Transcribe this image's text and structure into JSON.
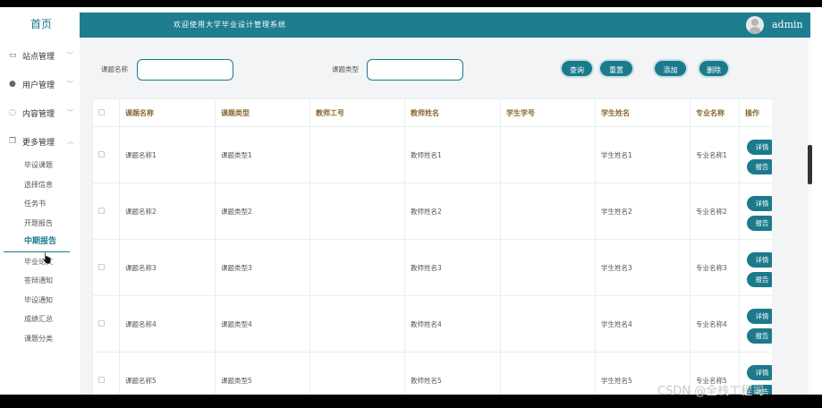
{
  "sidebar": {
    "home": "首页",
    "groups": [
      {
        "label": "站点管理",
        "icon": "monitor-icon"
      },
      {
        "label": "用户管理",
        "icon": "user-icon"
      },
      {
        "label": "内容管理",
        "icon": "chat-icon"
      },
      {
        "label": "更多管理",
        "icon": "copy-icon"
      }
    ],
    "items": [
      "毕设课题",
      "选择信息",
      "任务书",
      "开题报告",
      "中期报告",
      "毕业论文",
      "答辩通知",
      "毕设通知",
      "成绩汇总",
      "课题分类"
    ],
    "active_item": "中期报告"
  },
  "header": {
    "welcome": "欢迎使用大学毕业设计管理系统",
    "username": "admin"
  },
  "search": {
    "title_label": "课题名称",
    "title_value": "",
    "type_label": "课题类型",
    "type_value": ""
  },
  "buttons": {
    "query": "查询",
    "reset": "重置",
    "add": "添加",
    "delete": "删除"
  },
  "table": {
    "headers": [
      "课题名称",
      "课题类型",
      "教师工号",
      "教师姓名",
      "学生学号",
      "学生姓名",
      "专业名称",
      "操作"
    ],
    "rows": [
      {
        "title": "课题名称1",
        "type": "课题类型1",
        "teacher_id": "",
        "teacher_name": "教师姓名1",
        "student_id": "",
        "student_name": "学生姓名1",
        "major": "专业名称1"
      },
      {
        "title": "课题名称2",
        "type": "课题类型2",
        "teacher_id": "",
        "teacher_name": "教师姓名2",
        "student_id": "",
        "student_name": "学生姓名2",
        "major": "专业名称2"
      },
      {
        "title": "课题名称3",
        "type": "课题类型3",
        "teacher_id": "",
        "teacher_name": "教师姓名3",
        "student_id": "",
        "student_name": "学生姓名3",
        "major": "专业名称3"
      },
      {
        "title": "课题名称4",
        "type": "课题类型4",
        "teacher_id": "",
        "teacher_name": "教师姓名4",
        "student_id": "",
        "student_name": "学生姓名4",
        "major": "专业名称4"
      },
      {
        "title": "课题名称5",
        "type": "课题类型5",
        "teacher_id": "",
        "teacher_name": "教师姓名5",
        "student_id": "",
        "student_name": "学生姓名5",
        "major": "专业名称5"
      }
    ],
    "detail_label": "详情",
    "report_label": "报告"
  },
  "watermark": "CSDN @全栈工程司",
  "colors": {
    "accent": "#1b7a8c",
    "header_bg": "#1e7d8f",
    "th_text": "#8a6a30"
  }
}
